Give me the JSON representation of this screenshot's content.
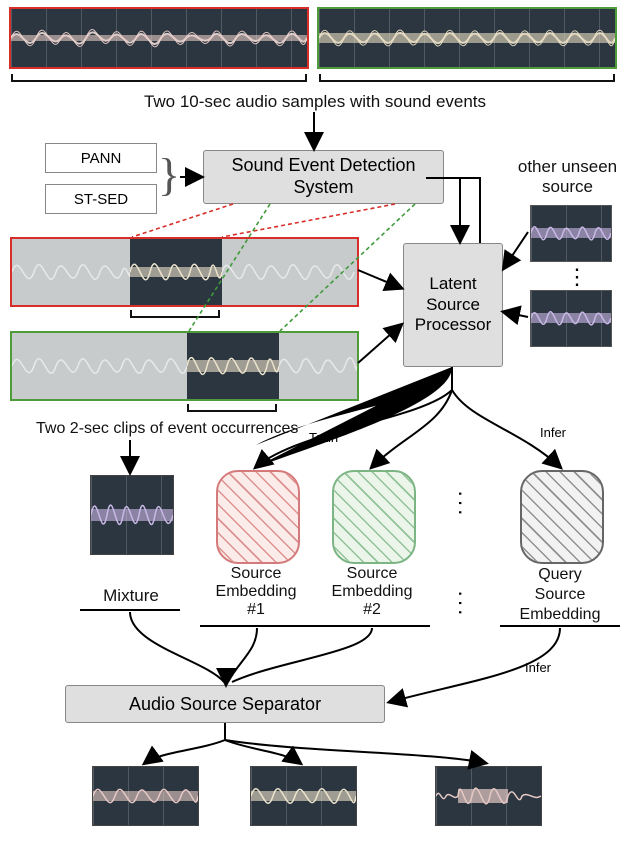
{
  "caption": "Two 10-sec audio samples with sound events",
  "sed_box": "Sound Event Detection System",
  "sed_options": {
    "opt1": "PANN",
    "opt2": "ST-SED"
  },
  "unseen_label": "other unseen\nsource",
  "latent_box": "Latent\nSource\nProcessor",
  "clip_caption": "Two 2-sec clips of event occurrences",
  "train_label": "Train",
  "infer_label": "Infer",
  "infer_label2": "Infer",
  "mixture_label": "Mixture",
  "src1_label": "Source\nEmbedding\n#1",
  "src2_label": "Source\nEmbedding\n#2",
  "query_label": "Query\nSource\nEmbedding",
  "separator_label": "Audio Source Separator"
}
